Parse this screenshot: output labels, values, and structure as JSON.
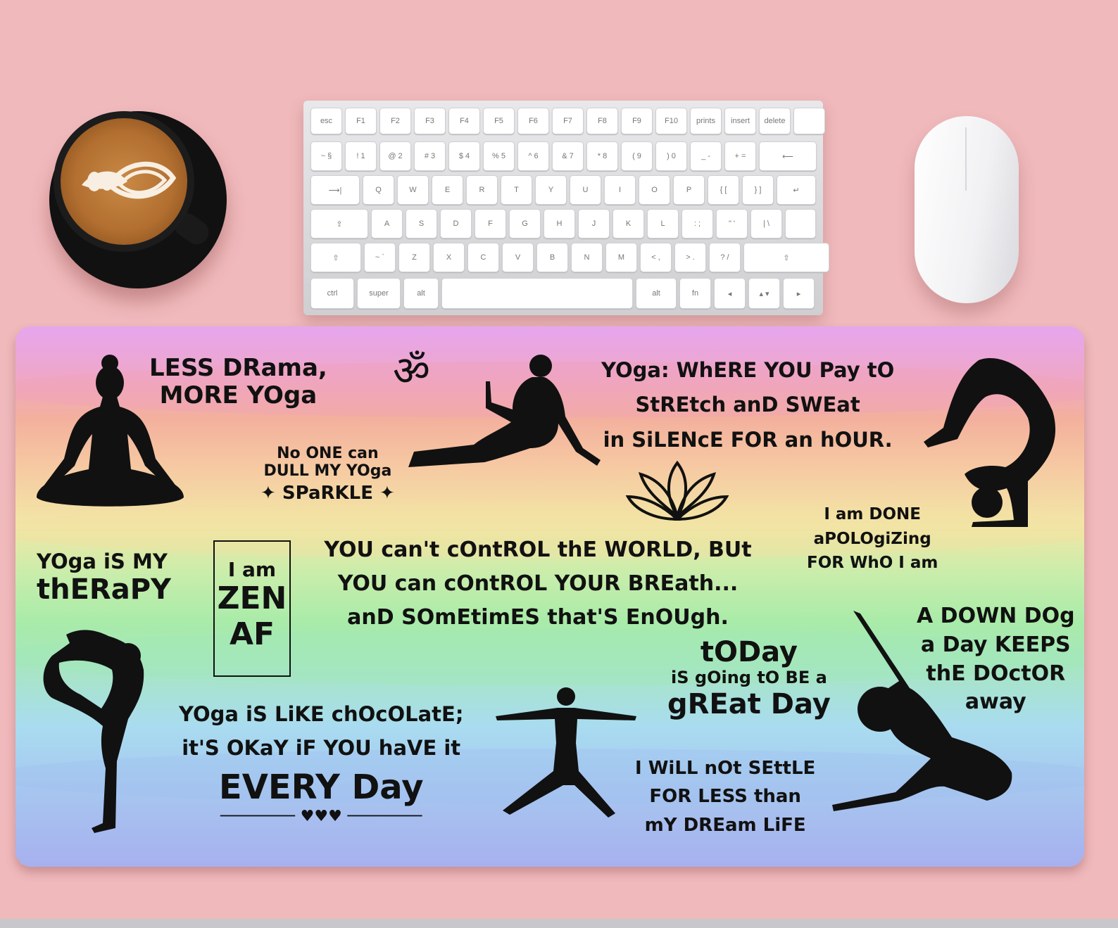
{
  "keyboard": {
    "rows": [
      [
        "esc",
        "F1",
        "F2",
        "F3",
        "F4",
        "F5",
        "F6",
        "F7",
        "F8",
        "F9",
        "F10",
        "prints",
        "insert",
        "delete",
        ""
      ],
      [
        "~ §",
        "! 1",
        "@ 2",
        "# 3",
        "$ 4",
        "% 5",
        "^ 6",
        "& 7",
        "* 8",
        "( 9",
        ") 0",
        "_ -",
        "+ =",
        "⟵"
      ],
      [
        "⟶|",
        "Q",
        "W",
        "E",
        "R",
        "T",
        "Y",
        "U",
        "I",
        "O",
        "P",
        "{ [",
        "} ]",
        "↵"
      ],
      [
        "⇪",
        "A",
        "S",
        "D",
        "F",
        "G",
        "H",
        "J",
        "K",
        "L",
        ": ;",
        "\" '",
        "| \\"
      ],
      [
        "⇧",
        "~ `",
        "Z",
        "X",
        "C",
        "V",
        "B",
        "N",
        "M",
        "< ,",
        "> .",
        "? /",
        "⇧"
      ],
      [
        "ctrl",
        "super",
        "alt",
        "",
        "alt",
        "fn",
        "◂",
        "▴ ▾",
        "▸"
      ]
    ]
  },
  "mat": {
    "less_drama": [
      "LESS DRama,",
      "MORE YOga"
    ],
    "no_one_can": [
      "No ONE can",
      "DULL MY YOga",
      "SPaRKLE"
    ],
    "yoga_where": [
      "YOga: WhERE YOU Pay tO",
      "StREtch anD SWEat",
      "in SiLENcE FOR an hOUR."
    ],
    "i_am_done": [
      "I am DONE",
      "aPOLOgiZing",
      "FOR WhO I am"
    ],
    "yoga_therapy": [
      "YOga iS MY",
      "thERaPY"
    ],
    "zen": [
      "I am",
      "ZEN",
      "AF"
    ],
    "control_world": [
      "YOU can't cOntROL thE WORLD, BUt",
      "YOU can cOntROL YOUR BREath...",
      "anD SOmEtimES that'S EnOUgh."
    ],
    "down_dog": [
      "A DOWN DOg",
      "a Day KEEPS",
      "thE DOctOR",
      "away"
    ],
    "today": [
      "tODay",
      "iS gOing tO BE a",
      "gREat Day"
    ],
    "chocolate": [
      "YOga iS LiKE chOcOLatE;",
      "it'S OKaY iF YOU haVE it",
      "EVERY Day"
    ],
    "not_settle": [
      "I WiLL nOt SEttLE",
      "FOR LESS than",
      "mY DREam LiFE"
    ],
    "om_symbol": "ॐ"
  },
  "colors": {
    "background": "#f0b9bb",
    "ink": "#111111"
  }
}
